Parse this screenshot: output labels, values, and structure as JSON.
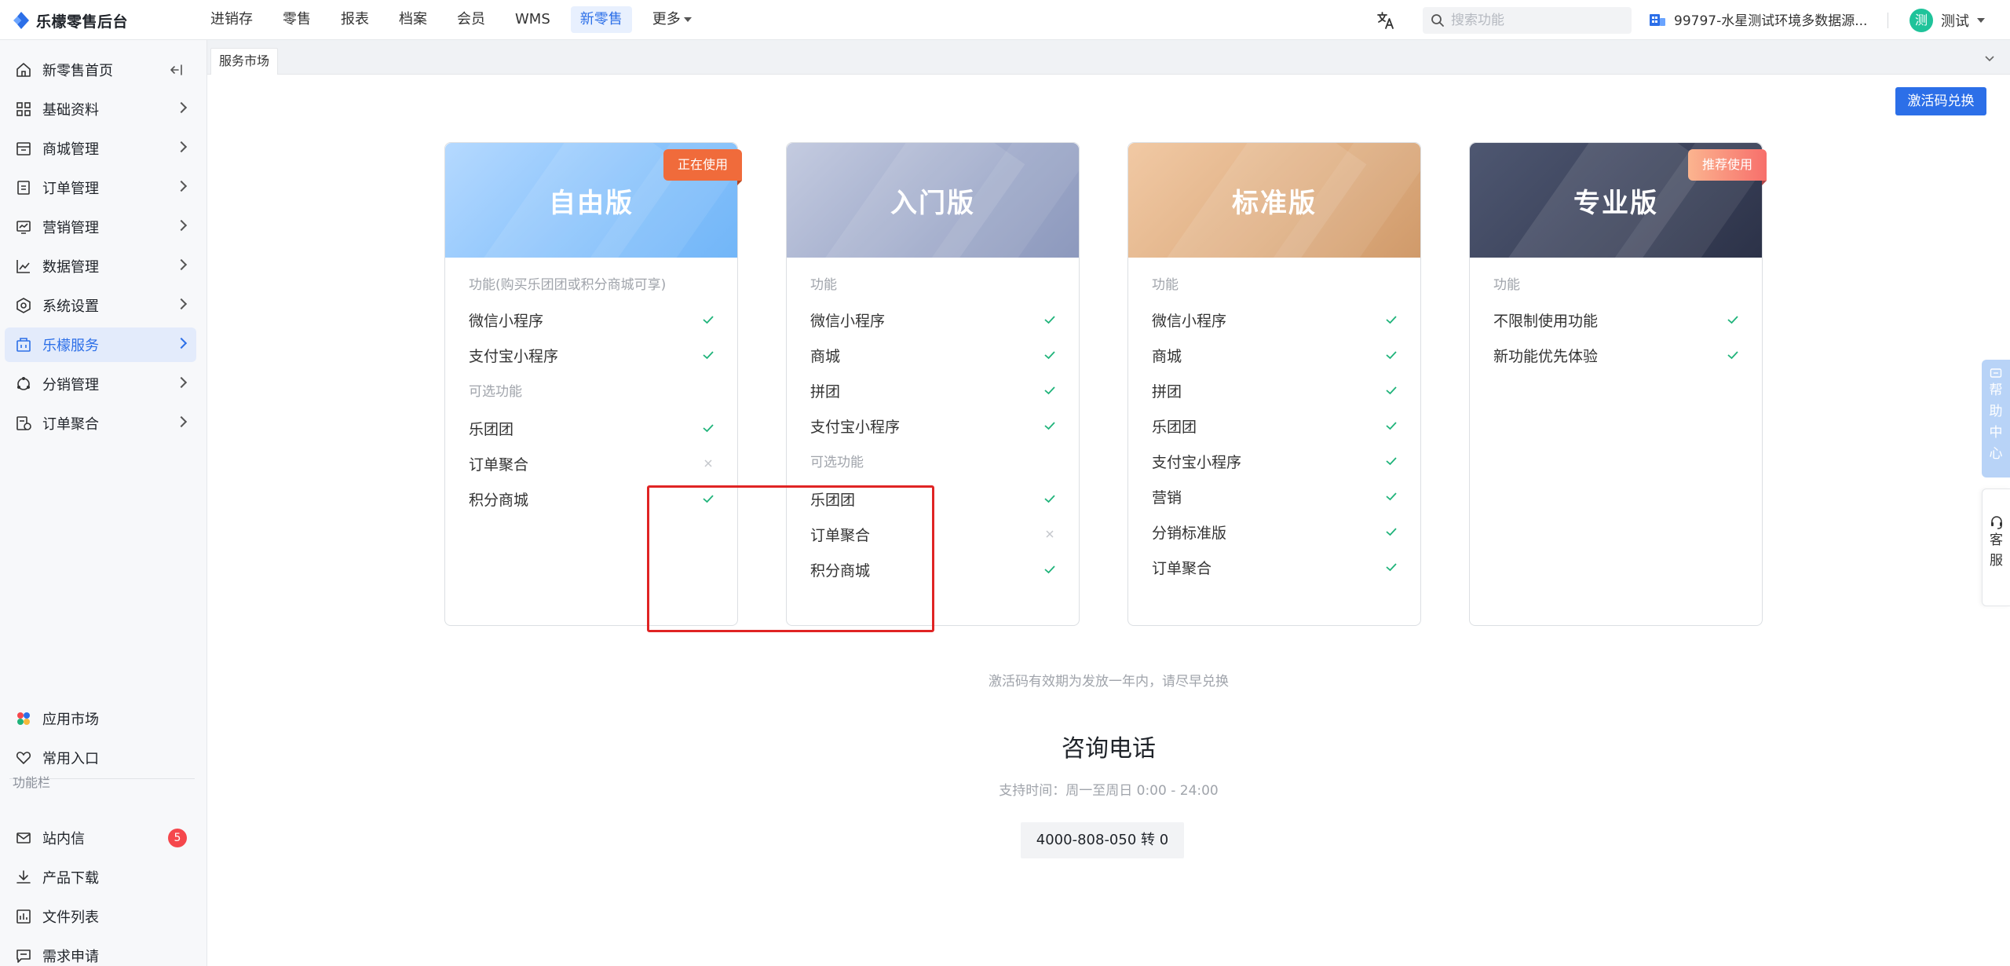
{
  "app": {
    "title": "乐檬零售后台"
  },
  "topnav": {
    "items": [
      {
        "label": "进销存"
      },
      {
        "label": "零售"
      },
      {
        "label": "报表"
      },
      {
        "label": "档案"
      },
      {
        "label": "会员"
      },
      {
        "label": "WMS"
      },
      {
        "label": "新零售",
        "active": true
      },
      {
        "label": "更多"
      }
    ],
    "search_placeholder": "搜索功能",
    "store_name": "99797-水星测试环境多数据源...",
    "user_avatar": "测",
    "user_name": "测试"
  },
  "sidebar": {
    "items": [
      {
        "label": "新零售首页",
        "icon": "home-icon"
      },
      {
        "label": "基础资料",
        "icon": "grid-icon"
      },
      {
        "label": "商城管理",
        "icon": "store-icon"
      },
      {
        "label": "订单管理",
        "icon": "order-icon"
      },
      {
        "label": "营销管理",
        "icon": "marketing-icon"
      },
      {
        "label": "数据管理",
        "icon": "chart-icon"
      },
      {
        "label": "系统设置",
        "icon": "settings-icon"
      },
      {
        "label": "乐檬服务",
        "icon": "service-icon",
        "active": true
      },
      {
        "label": "分销管理",
        "icon": "distribution-icon"
      },
      {
        "label": "订单聚合",
        "icon": "aggregate-icon"
      }
    ],
    "bottom_items": [
      {
        "label": "应用市场",
        "icon": "app-market-icon"
      },
      {
        "label": "常用入口",
        "icon": "heart-icon"
      }
    ],
    "section_title": "功能栏",
    "func_items": [
      {
        "label": "站内信",
        "icon": "mail-icon",
        "badge": "5"
      },
      {
        "label": "产品下载",
        "icon": "download-icon"
      },
      {
        "label": "文件列表",
        "icon": "file-list-icon"
      },
      {
        "label": "需求申请",
        "icon": "request-icon"
      }
    ]
  },
  "tabs": [
    {
      "label": "服务市场"
    }
  ],
  "main": {
    "redeem_button": "激活码兑换",
    "cards": [
      {
        "title": "自由版",
        "badge": "正在使用",
        "section1_label": "功能(购买乐团团或积分商城可享)",
        "section1": [
          {
            "name": "微信小程序",
            "included": true
          },
          {
            "name": "支付宝小程序",
            "included": true
          }
        ],
        "section2_label": "可选功能",
        "section2": [
          {
            "name": "乐团团",
            "included": true
          },
          {
            "name": "订单聚合",
            "included": false
          },
          {
            "name": "积分商城",
            "included": true
          }
        ]
      },
      {
        "title": "入门版",
        "section1_label": "功能",
        "section1": [
          {
            "name": "微信小程序",
            "included": true
          },
          {
            "name": "商城",
            "included": true
          },
          {
            "name": "拼团",
            "included": true
          },
          {
            "name": "支付宝小程序",
            "included": true
          }
        ],
        "section2_label": "可选功能",
        "section2": [
          {
            "name": "乐团团",
            "included": true
          },
          {
            "name": "订单聚合",
            "included": false
          },
          {
            "name": "积分商城",
            "included": true
          }
        ]
      },
      {
        "title": "标准版",
        "section1_label": "功能",
        "section1": [
          {
            "name": "微信小程序",
            "included": true
          },
          {
            "name": "商城",
            "included": true
          },
          {
            "name": "拼团",
            "included": true
          },
          {
            "name": "乐团团",
            "included": true
          },
          {
            "name": "支付宝小程序",
            "included": true
          },
          {
            "name": "营销",
            "included": true
          },
          {
            "name": "分销标准版",
            "included": true
          },
          {
            "name": "订单聚合",
            "included": true
          }
        ]
      },
      {
        "title": "专业版",
        "badge": "推荐使用",
        "section1_label": "功能",
        "section1": [
          {
            "name": "不限制使用功能",
            "included": true
          },
          {
            "name": "新功能优先体验",
            "included": true
          }
        ]
      }
    ],
    "note": "激活码有效期为发放一年内，请尽早兑换",
    "hotline_title": "咨询电话",
    "hours": "支持时间：周一至周日 0:00 - 24:00",
    "phone": "4000-808-050 转 0"
  },
  "floating": {
    "help": [
      "帮",
      "助",
      "中",
      "心"
    ],
    "service": [
      "客",
      "服"
    ]
  },
  "colors": {
    "accent": "#2c6fe8",
    "check": "#1fb37a",
    "badge_red": "#f5474c",
    "highlight": "#e02424"
  }
}
